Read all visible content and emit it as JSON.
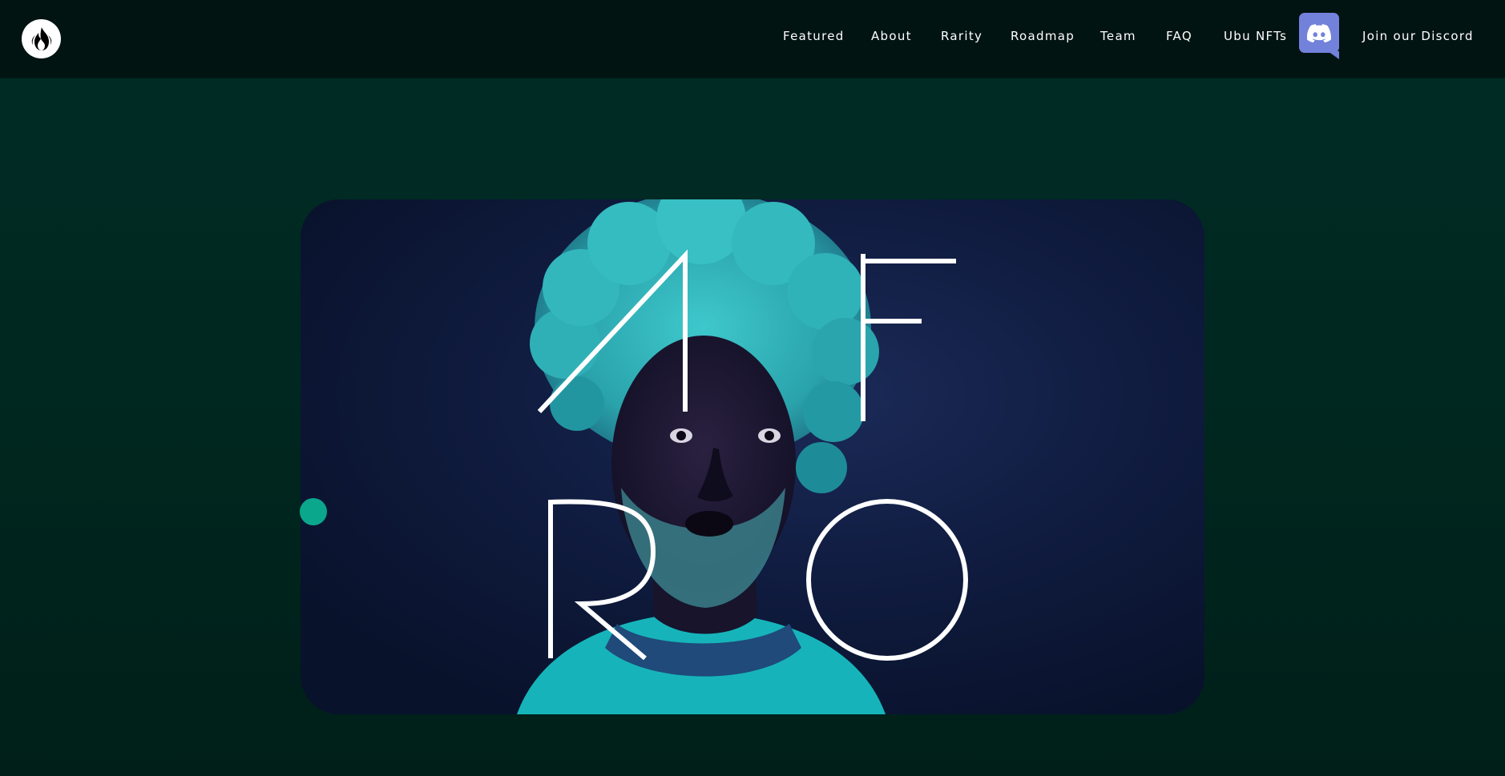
{
  "nav": {
    "items": [
      {
        "label": "Featured"
      },
      {
        "label": "About"
      },
      {
        "label": "Rarity"
      },
      {
        "label": "Roadmap"
      },
      {
        "label": "Team"
      },
      {
        "label": "FAQ"
      },
      {
        "label": "Ubu NFTs"
      }
    ],
    "discord_icon": "discord-icon",
    "join_label": "Join our Discord"
  },
  "logo": {
    "icon": "flame-icon"
  },
  "hero": {
    "letters": [
      "A",
      "F",
      "R",
      "O"
    ],
    "image": "portrait with turquoise afro hair"
  },
  "colors": {
    "topbar": "#021412",
    "background": "#002c26",
    "discord": "#7281da",
    "dot": "#0aa78c",
    "hair": "#35b7bd"
  }
}
